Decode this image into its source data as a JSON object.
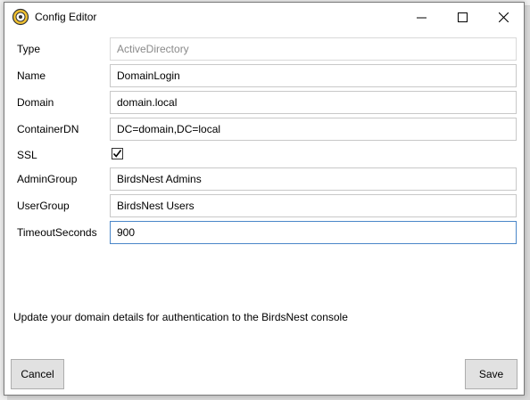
{
  "window": {
    "title": "Config Editor",
    "controls": {
      "minimize_icon": "minimize-icon",
      "maximize_icon": "maximize-icon",
      "close_icon": "close-icon"
    }
  },
  "form": {
    "type": {
      "label": "Type",
      "value": "ActiveDirectory"
    },
    "name": {
      "label": "Name",
      "value": "DomainLogin"
    },
    "domain": {
      "label": "Domain",
      "value": "domain.local"
    },
    "containerdn": {
      "label": "ContainerDN",
      "value": "DC=domain,DC=local"
    },
    "ssl": {
      "label": "SSL",
      "checked": true
    },
    "admingroup": {
      "label": "AdminGroup",
      "value": "BirdsNest Admins"
    },
    "usergroup": {
      "label": "UserGroup",
      "value": "BirdsNest Users"
    },
    "timeout": {
      "label": "TimeoutSeconds",
      "value": "900"
    }
  },
  "help_text": "Update your domain details for authentication to the BirdsNest console",
  "buttons": {
    "cancel": "Cancel",
    "save": "Save"
  },
  "colors": {
    "focus_border": "#4a86c8",
    "button_bg": "#e1e1e1",
    "readonly_text": "#8a8a8a"
  }
}
